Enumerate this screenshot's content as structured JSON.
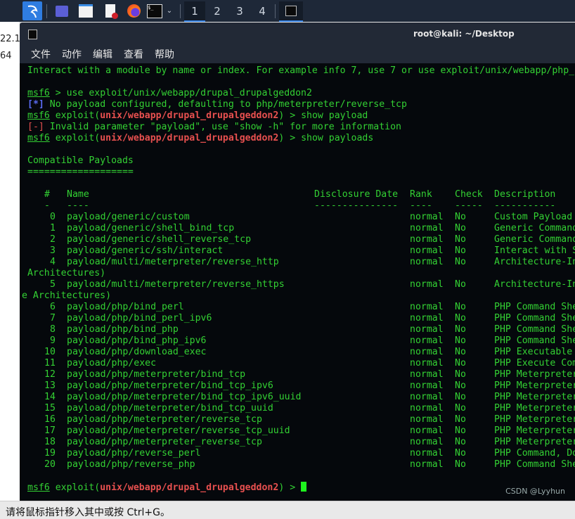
{
  "behind_window": {
    "fragments": [
      "22.1",
      "64"
    ]
  },
  "taskbar": {
    "workspaces": [
      "1",
      "2",
      "3",
      "4"
    ],
    "active_workspace": "1",
    "icons": [
      "kali-menu-icon",
      "desktop-icon",
      "file-manager-icon",
      "text-editor-icon",
      "firefox-icon",
      "terminal-icon",
      "chevron-down-icon",
      "terminal-window-icon"
    ]
  },
  "window": {
    "title": "root@kali: ~/Desktop",
    "menu": [
      "文件",
      "动作",
      "编辑",
      "查看",
      "帮助"
    ]
  },
  "colors": {
    "text": "#33d133",
    "module": "#e8504f",
    "info_marker": "#5b6cf5",
    "error_marker": "#e8504f",
    "background": "#05080c"
  },
  "terminal": {
    "intro": "Interact with a module by name or index. For example info 7, use 7 or use exploit/unix/webapp/php_",
    "prompt": "msf6",
    "cmd1": " > use exploit/unix/webapp/drupal_drupalgeddon2",
    "info_marker": "[*]",
    "info_text": " No payload configured, defaulting to php/meterpreter/reverse_tcp",
    "exploit_open": " exploit(",
    "module": "unix/webapp/drupal_drupalgeddon2",
    "exploit_close": ") > ",
    "cmd2": "show payload",
    "error_marker": "[-]",
    "error_text": " Invalid parameter \"payload\", use \"show -h\" for more information",
    "cmd3": "show payloads",
    "section_title": "Compatible Payloads",
    "section_underline": "===================",
    "headers": {
      "num": "#",
      "name": "Name",
      "date": "Disclosure Date",
      "rank": "Rank",
      "check": "Check",
      "desc": "Description"
    },
    "header_rules": {
      "num": "-",
      "name": "----",
      "date": "---------------",
      "rank": "----",
      "check": "-----",
      "desc": "-----------"
    },
    "rows": [
      {
        "num": "0",
        "name": "payload/generic/custom",
        "rank": "normal",
        "check": "No",
        "desc": "Custom Payload"
      },
      {
        "num": "1",
        "name": "payload/generic/shell_bind_tcp",
        "rank": "normal",
        "check": "No",
        "desc": "Generic Command"
      },
      {
        "num": "2",
        "name": "payload/generic/shell_reverse_tcp",
        "rank": "normal",
        "check": "No",
        "desc": "Generic Command"
      },
      {
        "num": "3",
        "name": "payload/generic/ssh/interact",
        "rank": "normal",
        "check": "No",
        "desc": "Interact with S"
      },
      {
        "num": "4",
        "name": "payload/multi/meterpreter/reverse_http",
        "rank": "normal",
        "check": "No",
        "desc": "Architecture-In",
        "wrap": " Architectures)"
      },
      {
        "num": "5",
        "name": "payload/multi/meterpreter/reverse_https",
        "rank": "normal",
        "check": "No",
        "desc": "Architecture-In",
        "wrap": "e Architectures)"
      },
      {
        "num": "6",
        "name": "payload/php/bind_perl",
        "rank": "normal",
        "check": "No",
        "desc": "PHP Command She"
      },
      {
        "num": "7",
        "name": "payload/php/bind_perl_ipv6",
        "rank": "normal",
        "check": "No",
        "desc": "PHP Command She"
      },
      {
        "num": "8",
        "name": "payload/php/bind_php",
        "rank": "normal",
        "check": "No",
        "desc": "PHP Command She"
      },
      {
        "num": "9",
        "name": "payload/php/bind_php_ipv6",
        "rank": "normal",
        "check": "No",
        "desc": "PHP Command She"
      },
      {
        "num": "10",
        "name": "payload/php/download_exec",
        "rank": "normal",
        "check": "No",
        "desc": "PHP Executable"
      },
      {
        "num": "11",
        "name": "payload/php/exec",
        "rank": "normal",
        "check": "No",
        "desc": "PHP Execute Com"
      },
      {
        "num": "12",
        "name": "payload/php/meterpreter/bind_tcp",
        "rank": "normal",
        "check": "No",
        "desc": "PHP Meterpreter"
      },
      {
        "num": "13",
        "name": "payload/php/meterpreter/bind_tcp_ipv6",
        "rank": "normal",
        "check": "No",
        "desc": "PHP Meterpreter"
      },
      {
        "num": "14",
        "name": "payload/php/meterpreter/bind_tcp_ipv6_uuid",
        "rank": "normal",
        "check": "No",
        "desc": "PHP Meterpreter"
      },
      {
        "num": "15",
        "name": "payload/php/meterpreter/bind_tcp_uuid",
        "rank": "normal",
        "check": "No",
        "desc": "PHP Meterpreter"
      },
      {
        "num": "16",
        "name": "payload/php/meterpreter/reverse_tcp",
        "rank": "normal",
        "check": "No",
        "desc": "PHP Meterpreter"
      },
      {
        "num": "17",
        "name": "payload/php/meterpreter/reverse_tcp_uuid",
        "rank": "normal",
        "check": "No",
        "desc": "PHP Meterpreter"
      },
      {
        "num": "18",
        "name": "payload/php/meterpreter_reverse_tcp",
        "rank": "normal",
        "check": "No",
        "desc": "PHP Meterpreter"
      },
      {
        "num": "19",
        "name": "payload/php/reverse_perl",
        "rank": "normal",
        "check": "No",
        "desc": "PHP Command, Do"
      },
      {
        "num": "20",
        "name": "payload/php/reverse_php",
        "rank": "normal",
        "check": "No",
        "desc": "PHP Command She"
      }
    ]
  },
  "status_bar": {
    "text": "请将鼠标指针移入其中或按 Ctrl+G。"
  },
  "watermark": "CSDN @Lyyhun"
}
